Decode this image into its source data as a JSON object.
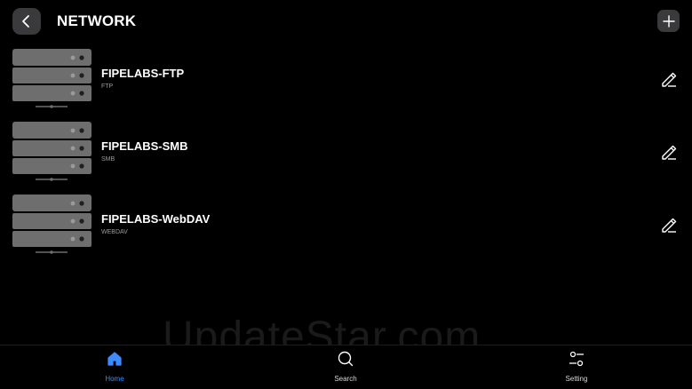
{
  "header": {
    "title": "NETWORK",
    "back_icon": "chevron-left-icon",
    "add_icon": "plus-icon"
  },
  "connections": [
    {
      "name": "FIPELABS-FTP",
      "type": "FTP"
    },
    {
      "name": "FIPELABS-SMB",
      "type": "SMB"
    },
    {
      "name": "FIPELABS-WebDAV",
      "type": "WEBDAV"
    }
  ],
  "watermark": "UpdateStar.com",
  "bottom_nav": {
    "items": [
      {
        "label": "Home",
        "icon": "home-icon",
        "active": true
      },
      {
        "label": "Search",
        "icon": "search-icon",
        "active": false
      },
      {
        "label": "Setting",
        "icon": "sliders-icon",
        "active": false
      }
    ]
  },
  "colors": {
    "background": "#000000",
    "accent": "#3d8bfd",
    "button_bg": "#3a3a3c",
    "server_gray": "#6e6e6e"
  }
}
